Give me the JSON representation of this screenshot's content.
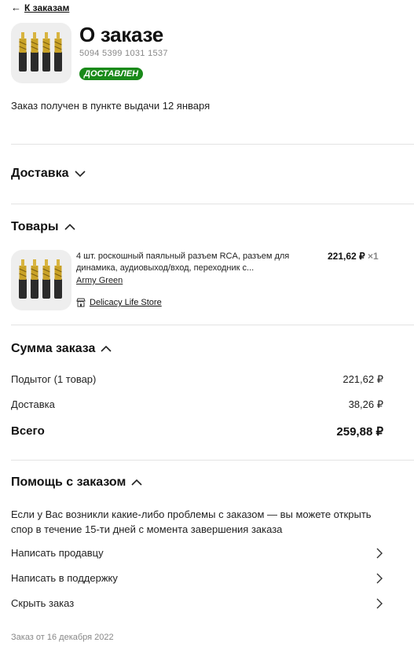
{
  "nav": {
    "back_label": "К заказам"
  },
  "header": {
    "title": "О заказе",
    "order_number": "5094 5399 1031 1537",
    "status_badge": "ДОСТАВЛЕН",
    "status_line": "Заказ получен в пункте выдачи 12 января"
  },
  "sections": {
    "delivery": "Доставка",
    "items": "Товары",
    "summary": "Сумма заказа",
    "help": "Помощь с заказом"
  },
  "product": {
    "name": "4 шт. роскошный паяльный разъем RCA, разъем для динамика, аудиовыход/вход, переходник с...",
    "variant": "Army Green",
    "price": "221,62 ₽",
    "quantity": "×1",
    "store": "Delicacy Life Store"
  },
  "summary": {
    "subtotal_label": "Подытог (1 товар)",
    "subtotal_value": "221,62 ₽",
    "delivery_label": "Доставка",
    "delivery_value": "38,26 ₽",
    "total_label": "Всего",
    "total_value": "259,88 ₽"
  },
  "help": {
    "text": "Если у Вас возникли какие-либо проблемы с заказом — вы можете открыть спор в течение 15-ти дней с момента завершения заказа",
    "links": [
      "Написать продавцу",
      "Написать в поддержку",
      "Скрыть заказ"
    ]
  },
  "footer": {
    "order_date": "Заказ от 16 декабря 2022"
  },
  "colors": {
    "status_badge": "#1a8a1a",
    "muted_text": "#888888",
    "divider": "#e3e3e3"
  }
}
